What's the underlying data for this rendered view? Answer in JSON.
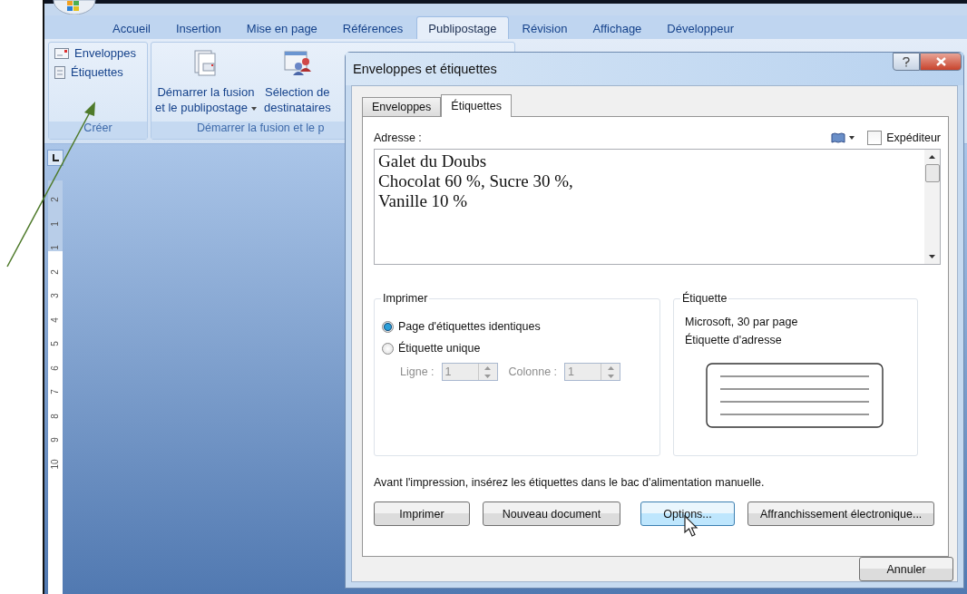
{
  "ribbon": {
    "tabs": [
      {
        "label": "Accueil",
        "selected": false
      },
      {
        "label": "Insertion",
        "selected": false
      },
      {
        "label": "Mise en page",
        "selected": false
      },
      {
        "label": "Références",
        "selected": false
      },
      {
        "label": "Publipostage",
        "selected": true
      },
      {
        "label": "Révision",
        "selected": false
      },
      {
        "label": "Affichage",
        "selected": false
      },
      {
        "label": "Développeur",
        "selected": false
      }
    ],
    "create_group": {
      "label": "Créer",
      "items": [
        {
          "label": "Enveloppes",
          "kind": "envelope"
        },
        {
          "label": "Étiquettes",
          "kind": "labels"
        }
      ]
    },
    "merge_group": {
      "label": "Démarrer la fusion et le p",
      "buttons": [
        {
          "lines": [
            "Démarrer la fusion",
            "et le publipostage"
          ],
          "dropdown": true,
          "kind": "merge"
        },
        {
          "lines": [
            "Sélection de",
            "destinataires"
          ],
          "dropdown": false,
          "kind": "recipients"
        }
      ]
    }
  },
  "ruler": {
    "numbers": [
      "2",
      "1",
      "1",
      "2",
      "3",
      "4",
      "5",
      "6",
      "7",
      "8",
      "9",
      "10"
    ]
  },
  "dialog": {
    "title": "Enveloppes et étiquettes",
    "tabs": [
      {
        "label": "Enveloppes",
        "selected": false
      },
      {
        "label": "Étiquettes",
        "selected": true
      }
    ],
    "address": {
      "label": "Adresse :",
      "lines": [
        "Galet du Doubs",
        "Chocolat 60 %, Sucre 30 %,",
        "Vanille 10 %"
      ]
    },
    "sender": {
      "label": "Expéditeur",
      "checked": false
    },
    "print_group": {
      "title": "Imprimer",
      "options": [
        {
          "label": "Page d'étiquettes identiques",
          "selected": true
        },
        {
          "label": "Étiquette unique",
          "selected": false
        }
      ],
      "disabled": true,
      "row_label": "Ligne :",
      "row_value": "1",
      "column_label": "Colonne :",
      "column_value": "1"
    },
    "label_group": {
      "title": "Étiquette",
      "lines": [
        "Microsoft, 30 par page",
        "Étiquette d'adresse"
      ]
    },
    "note": "Avant l'impression, insérez les étiquettes dans le bac d'alimentation manuelle.",
    "buttons": [
      {
        "label": "Imprimer",
        "focused": false
      },
      {
        "label": "Nouveau document",
        "focused": false
      },
      {
        "label": "Options...",
        "focused": true
      },
      {
        "label": "Affranchissement électronique...",
        "focused": false
      }
    ],
    "cancel": "Annuler"
  }
}
